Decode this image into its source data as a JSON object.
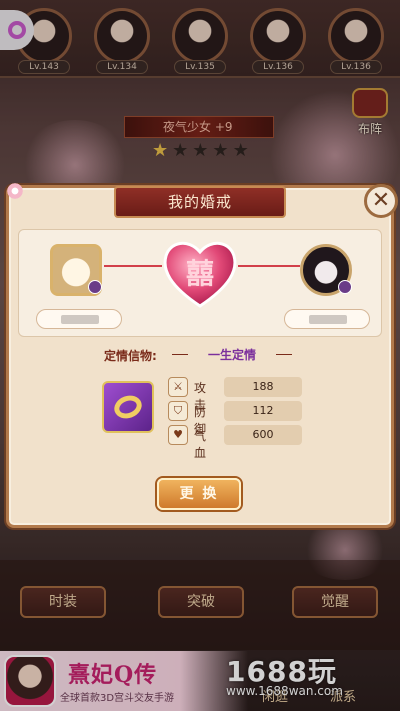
{
  "top_bar": {
    "heroes": [
      {
        "level": "Lv.143"
      },
      {
        "level": "Lv.134"
      },
      {
        "level": "Lv.135"
      },
      {
        "level": "Lv.136"
      },
      {
        "level": "Lv.136"
      }
    ]
  },
  "character": {
    "name": "夜气少女 +9",
    "stars_lit": 1,
    "stars_total": 5
  },
  "formation_label": "布阵",
  "dialog": {
    "title": "我的婚戒",
    "heart_glyph": "囍",
    "token_label": "定情信物:",
    "token_value": "一生定情",
    "stats": [
      {
        "icon": "sword-icon",
        "label": "攻击",
        "value": "188"
      },
      {
        "icon": "shield-icon",
        "label": "防御",
        "value": "112"
      },
      {
        "icon": "heart-icon",
        "label": "气血",
        "value": "600"
      }
    ],
    "change_button": "更 换"
  },
  "bottom_buttons": [
    "时装",
    "突破",
    "觉醒"
  ],
  "footer_tabs": [
    "闲逛",
    "派系"
  ],
  "ad": {
    "title": "熹妃Q传",
    "subtitle": "全球首款3D宫斗交友手游"
  },
  "watermark": {
    "logo": "1688玩",
    "url": "www.1688wan.com"
  },
  "colors": {
    "accent_red": "#8f2f26",
    "heart_pink": "#e24a78",
    "token_purple": "#7b2f9c",
    "button_orange": "#cf7a2c"
  }
}
